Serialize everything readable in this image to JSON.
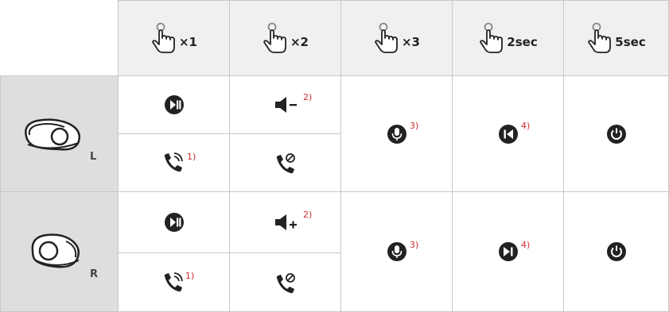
{
  "headers": [
    {
      "label": "×1",
      "icon": "tap-hand-icon"
    },
    {
      "label": "×2",
      "icon": "tap-hand-icon"
    },
    {
      "label": "×3",
      "icon": "tap-hand-icon"
    },
    {
      "label": "2sec",
      "icon": "tap-hand-icon"
    },
    {
      "label": "5sec",
      "icon": "tap-hand-icon"
    }
  ],
  "left": {
    "label": "L",
    "play_icon": "play-pause-icon",
    "volume_down_icon": "volume-down-icon",
    "volume_down_note": "2)",
    "answer_icon": "answer-call-icon",
    "answer_note": "1)",
    "reject_icon": "reject-call-icon",
    "voice_icon": "voice-assistant-icon",
    "voice_note": "3)",
    "track_icon": "previous-track-icon",
    "track_note": "4)",
    "power_icon": "power-icon"
  },
  "right": {
    "label": "R",
    "play_icon": "play-pause-icon",
    "volume_up_icon": "volume-up-icon",
    "volume_up_note": "2)",
    "answer_icon": "answer-call-icon",
    "answer_note": "1)",
    "reject_icon": "reject-call-icon",
    "voice_icon": "voice-assistant-icon",
    "voice_note": "3)",
    "track_icon": "next-track-icon",
    "track_note": "4)",
    "power_icon": "power-icon"
  },
  "colors": {
    "note": "#d22b2b",
    "header_bg": "#f0f0f0",
    "side_bg": "#dedede",
    "border": "#c8c8c8",
    "icon": "#222222"
  }
}
